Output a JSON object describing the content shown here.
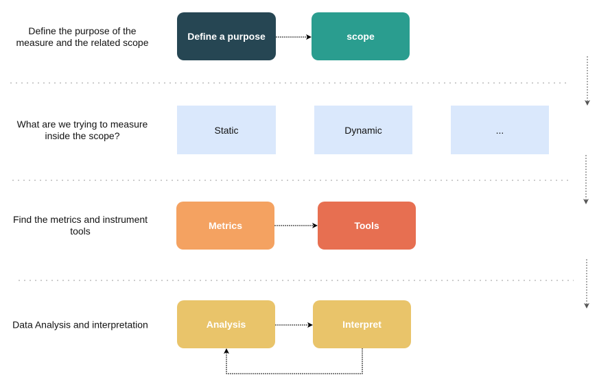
{
  "rows": [
    {
      "label": "Define the purpose of the measure and the related scope",
      "boxes": [
        "Define a purpose",
        "scope"
      ]
    },
    {
      "label": "What are we trying to measure inside the scope?",
      "boxes": [
        "Static",
        "Dynamic",
        "..."
      ]
    },
    {
      "label": "Find the metrics and instrument tools",
      "boxes": [
        "Metrics",
        "Tools"
      ]
    },
    {
      "label": "Data Analysis and interpretation",
      "boxes": [
        "Analysis",
        "Interpret"
      ]
    }
  ],
  "colors": {
    "define": "#264653",
    "scope": "#2a9d8f",
    "light": "#dae8fc",
    "metrics": "#f4a261",
    "tools": "#e76f51",
    "analysis": "#e9c46a"
  }
}
